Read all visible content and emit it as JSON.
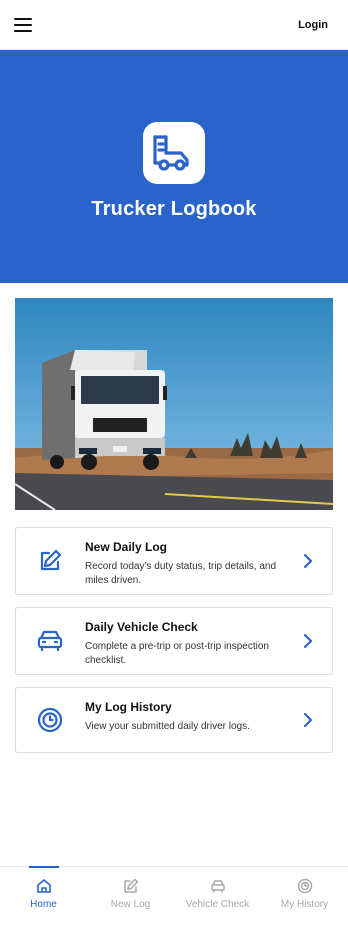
{
  "header": {
    "login_label": "Login"
  },
  "hero": {
    "title": "Trucker Logbook"
  },
  "cards": [
    {
      "title": "New Daily Log",
      "desc": "Record today’s duty status, trip details, and miles driven.",
      "icon": "edit-icon"
    },
    {
      "title": "Daily Vehicle Check",
      "desc": "Complete a pre-trip or post-trip inspection checklist.",
      "icon": "car-icon"
    },
    {
      "title": "My Log History",
      "desc": "View your submitted daily driver logs.",
      "icon": "history-icon"
    }
  ],
  "nav": [
    {
      "label": "Home",
      "icon": "home-icon",
      "active": true
    },
    {
      "label": "New Log",
      "icon": "edit-icon",
      "active": false
    },
    {
      "label": "Vehicle Check",
      "icon": "car-icon",
      "active": false
    },
    {
      "label": "My History",
      "icon": "history-icon",
      "active": false
    }
  ],
  "colors": {
    "accent": "#2a63c9",
    "inactive": "#a8a8a8"
  }
}
